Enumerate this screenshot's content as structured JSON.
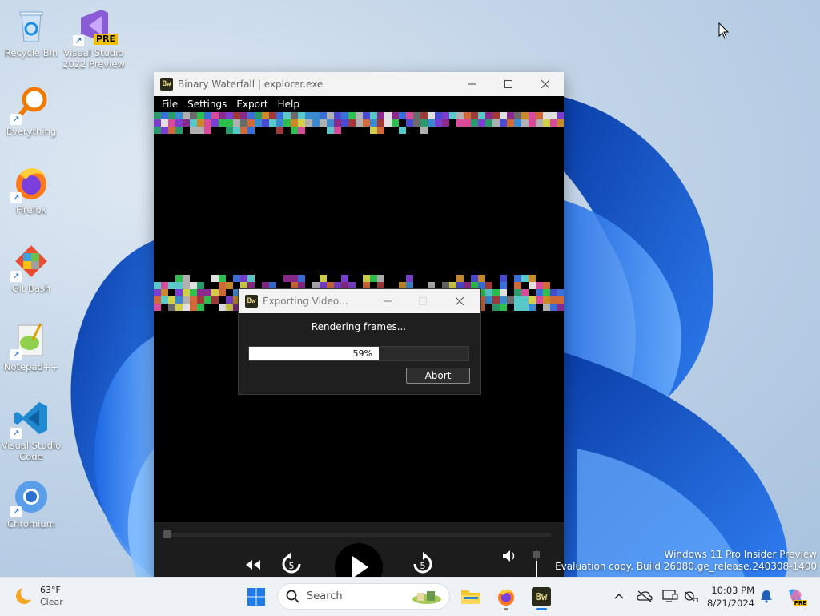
{
  "desktop_icons": [
    {
      "label": "Recycle Bin",
      "icon": "recycle-bin-icon"
    },
    {
      "label": "Visual Studio 2022 Preview",
      "icon": "visual-studio-preview-icon",
      "badge": "PRE"
    },
    {
      "label": "Everything",
      "icon": "everything-search-icon"
    },
    {
      "label": "Firefox",
      "icon": "firefox-icon"
    },
    {
      "label": "Git Bash",
      "icon": "git-bash-icon"
    },
    {
      "label": "Notepad++",
      "icon": "notepad-plus-plus-icon"
    },
    {
      "label": "Visual Studio Code",
      "icon": "vscode-icon"
    },
    {
      "label": "Chromium",
      "icon": "chromium-icon"
    }
  ],
  "window": {
    "app_icon_text": "Bw",
    "title": "Binary Waterfall | explorer.exe",
    "menu": [
      "File",
      "Settings",
      "Export",
      "Help"
    ]
  },
  "dialog": {
    "title": "Exporting Video...",
    "status": "Rendering frames...",
    "progress_percent": 59,
    "progress_label": "59%",
    "abort_label": "Abort"
  },
  "watermark": {
    "line1": "Windows 11 Pro Insider Preview",
    "line2": "Evaluation copy. Build 26080.ge_release.240308-1400"
  },
  "taskbar": {
    "weather_temp": "63°F",
    "weather_cond": "Clear",
    "search_placeholder": "Search",
    "time": "10:03 PM",
    "date": "8/21/2024",
    "copilot_badge": "PRE",
    "pinned": [
      "start-icon",
      "search-icon",
      "file-explorer-icon",
      "firefox-icon",
      "binary-waterfall-icon"
    ]
  },
  "colors": {
    "accent_blue": "#1565d8",
    "window_bg": "#000000",
    "titlebar_bg": "#f3f3f3",
    "progress_fill": "#ffffff"
  }
}
